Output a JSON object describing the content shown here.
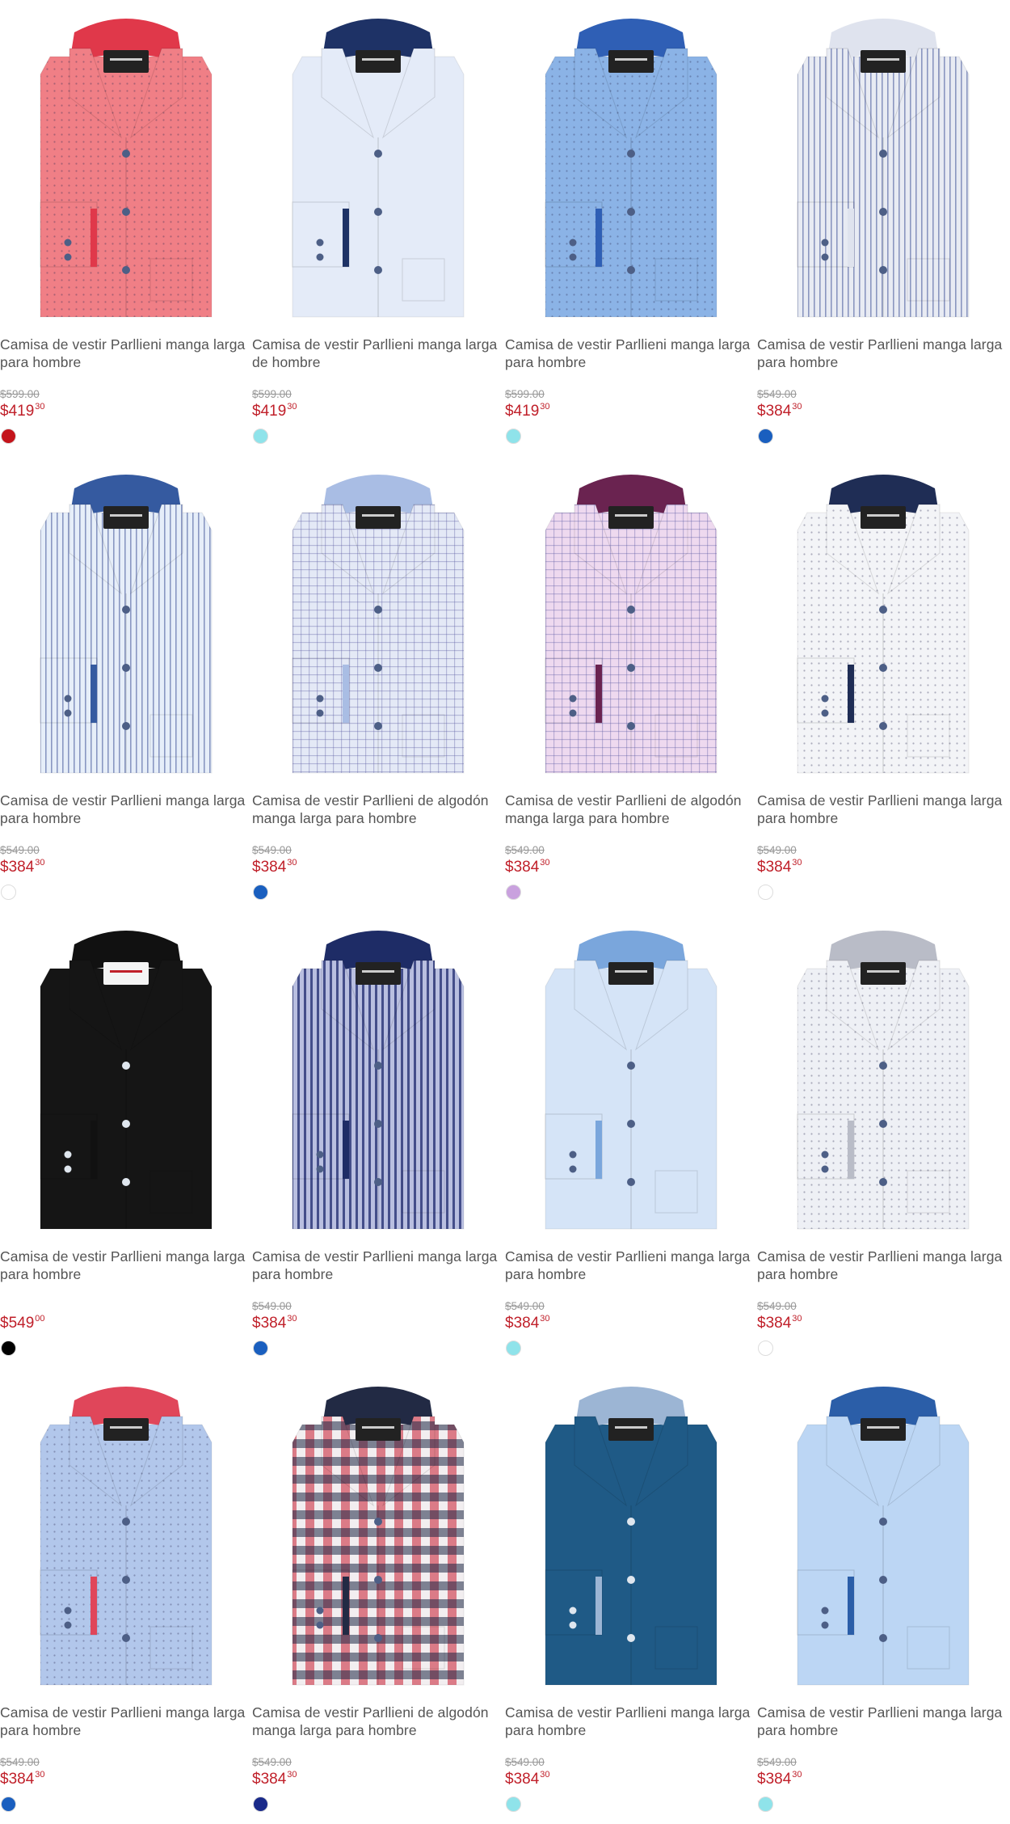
{
  "products": [
    {
      "title": "Camisa de vestir Parllieni manga larga para hombre",
      "old_price": "$599.00",
      "price_int": "$419",
      "price_cents": "30",
      "swatch": "#c4141b",
      "body": "#f07f86",
      "collar": "#e0384a",
      "stripe": "dots"
    },
    {
      "title": "Camisa de vestir Parllieni manga larga de hombre",
      "old_price": "$599.00",
      "price_int": "$419",
      "price_cents": "30",
      "swatch": "#8fe3ea",
      "body": "#e4ebf8",
      "collar": "#1e3266",
      "stripe": "none"
    },
    {
      "title": "Camisa de vestir Parllieni manga larga para hombre",
      "old_price": "$599.00",
      "price_int": "$419",
      "price_cents": "30",
      "swatch": "#8fe3ea",
      "body": "#8bb3e6",
      "collar": "#2f5fb5",
      "stripe": "dots"
    },
    {
      "title": "Camisa de vestir Parllieni manga larga para hombre",
      "old_price": "$549.00",
      "price_int": "$384",
      "price_cents": "30",
      "swatch": "#1a5fbf",
      "body": "#e8ebf3",
      "collar": "#dfe3ee",
      "stripe": "vstripe"
    },
    {
      "title": "Camisa de vestir Parllieni manga larga para hombre",
      "old_price": "$549.00",
      "price_int": "$384",
      "price_cents": "30",
      "swatch": "#ffffff",
      "body": "#e6eef9",
      "collar": "#355aa0",
      "stripe": "vstripe"
    },
    {
      "title": "Camisa de vestir Parllieni de algodón manga larga para hombre",
      "old_price": "$549.00",
      "price_int": "$384",
      "price_cents": "30",
      "swatch": "#1a5fbf",
      "body": "#e4e9f6",
      "collar": "#a9bde4",
      "stripe": "check"
    },
    {
      "title": "Camisa de vestir Parllieni de algodón manga larga para hombre",
      "old_price": "$549.00",
      "price_int": "$384",
      "price_cents": "30",
      "swatch": "#c9a1de",
      "body": "#eed9ef",
      "collar": "#6a2350",
      "stripe": "check"
    },
    {
      "title": "Camisa de vestir Parllieni manga larga para hombre",
      "old_price": "$549.00",
      "price_int": "$384",
      "price_cents": "30",
      "swatch": "#ffffff",
      "body": "#f3f4f7",
      "collar": "#1f2d55",
      "stripe": "dots"
    },
    {
      "title": "Camisa de vestir Parllieni manga larga para hombre",
      "old_price": "",
      "price_int": "$549",
      "price_cents": "00",
      "swatch": "#000000",
      "body": "#151515",
      "collar": "#111111",
      "stripe": "none"
    },
    {
      "title": "Camisa de vestir Parllieni manga larga para hombre",
      "old_price": "$549.00",
      "price_int": "$384",
      "price_cents": "30",
      "swatch": "#1a5fbf",
      "body": "#b9bfe0",
      "collar": "#1e2c66",
      "stripe": "vstripe-dark"
    },
    {
      "title": "Camisa de vestir Parllieni manga larga para hombre",
      "old_price": "$549.00",
      "price_int": "$384",
      "price_cents": "30",
      "swatch": "#8fe3ea",
      "body": "#d5e4f7",
      "collar": "#7aa6dc",
      "stripe": "none"
    },
    {
      "title": "Camisa de vestir Parllieni manga larga para hombre",
      "old_price": "$549.00",
      "price_int": "$384",
      "price_cents": "30",
      "swatch": "#ffffff",
      "body": "#eef0f5",
      "collar": "#b9bcc7",
      "stripe": "dots"
    },
    {
      "title": "Camisa de vestir Parllieni manga larga para hombre",
      "old_price": "$549.00",
      "price_int": "$384",
      "price_cents": "30",
      "swatch": "#1a5fbf",
      "body": "#b2c7eb",
      "collar": "#e0465a",
      "stripe": "dots"
    },
    {
      "title": "Camisa de vestir Parllieni de algodón manga larga para hombre",
      "old_price": "$549.00",
      "price_int": "$384",
      "price_cents": "30",
      "swatch": "#1a2a8a",
      "body": "#ede6ec",
      "collar": "#222a44",
      "stripe": "gingham"
    },
    {
      "title": "Camisa de vestir Parllieni manga larga para hombre",
      "old_price": "$549.00",
      "price_int": "$384",
      "price_cents": "30",
      "swatch": "#8fe3ea",
      "body": "#1f5a86",
      "collar": "#9cb5d4",
      "stripe": "none"
    },
    {
      "title": "Camisa de vestir Parllieni manga larga para hombre",
      "old_price": "$549.00",
      "price_int": "$384",
      "price_cents": "30",
      "swatch": "#8fe3ea",
      "body": "#bcd6f4",
      "collar": "#2b5ea8",
      "stripe": "none"
    }
  ]
}
